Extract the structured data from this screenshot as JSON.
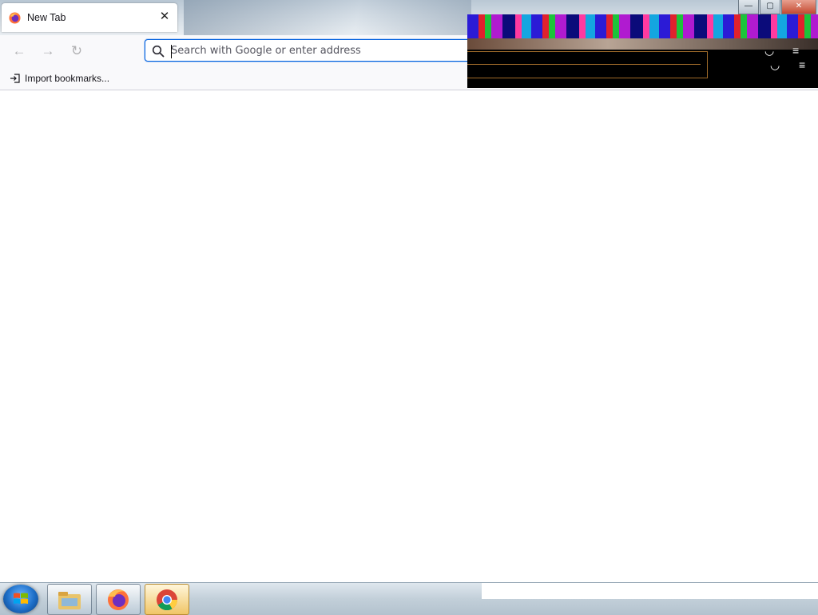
{
  "browser": {
    "tab": {
      "title": "New Tab",
      "close_glyph": "✕",
      "favicon": "firefox-icon"
    },
    "window_controls": {
      "minimize": "—",
      "maximize": "▢",
      "close": "✕"
    },
    "nav": {
      "back_glyph": "←",
      "forward_glyph": "→",
      "reload_glyph": "↻",
      "address_placeholder": "Search with Google or enter address",
      "address_value": ""
    },
    "toolbar_icons": [
      "pocket-icon",
      "menu-icon"
    ],
    "bookmarks": {
      "import_label": "Import bookmarks..."
    }
  },
  "taskbar": {
    "items": [
      "windows-start-button",
      "file-explorer-icon",
      "firefox-icon",
      "chrome-icon"
    ],
    "active_item": "chrome-icon"
  },
  "colors": {
    "focus_ring": "#0060df",
    "toolbar_bg": "#f9f9fb",
    "taskbar_active": "#f0c566"
  }
}
